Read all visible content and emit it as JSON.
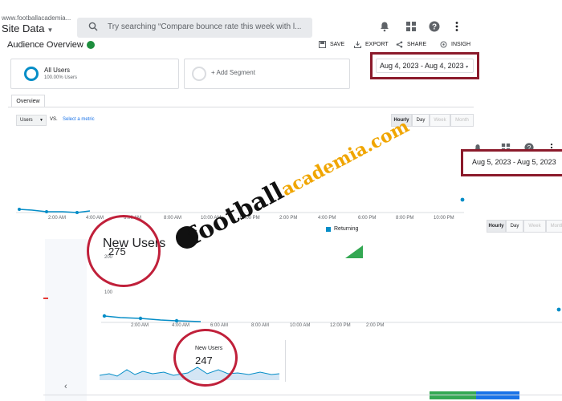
{
  "topbar": {
    "site_url": "www.footballacademia...",
    "site_title": "Site Data",
    "search_placeholder": "Try searching “Compare bounce rate this week with l..."
  },
  "page": {
    "title": "Audience Overview",
    "actions": [
      "SAVE",
      "EXPORT",
      "SHARE",
      "INSIGH"
    ]
  },
  "segments": {
    "all_users_label": "All Users",
    "all_users_sub": "100.00% Users",
    "add_segment": "+ Add Segment"
  },
  "tabs": {
    "overview": "Overview"
  },
  "metric_controls": {
    "metric": "Users",
    "vs": "VS.",
    "select_metric": "Select a metric",
    "time_buttons": [
      "Hourly",
      "Day",
      "Week",
      "Month"
    ]
  },
  "chart1": {
    "x_ticks": [
      "2:00 AM",
      "4:00 AM",
      "6:00 AM",
      "8:00 AM",
      "10:00 AM",
      "12:00 PM",
      "2:00 PM",
      "4:00 PM",
      "6:00 PM",
      "8:00 PM",
      "10:00 PM"
    ],
    "legend_returning": "Returning",
    "new_users_label": "New Users",
    "new_users_value": "275"
  },
  "date_ranges": {
    "first": "Aug 4, 2023 - Aug 4, 2023",
    "second": "Aug 5, 2023 - Aug 5, 2023"
  },
  "second_screen": {
    "time_buttons": [
      "Hourly",
      "Day",
      "Week",
      "Month"
    ],
    "y_ticks": [
      "200",
      "100"
    ],
    "x_ticks": [
      "2:00 AM",
      "4:00 AM",
      "6:00 AM",
      "8:00 AM",
      "10:00 AM",
      "12:00 PM",
      "2:00 PM"
    ],
    "new_users_label": "New Users",
    "new_users_value": "247"
  },
  "watermark": {
    "part1": "football",
    "part2": "academia.com"
  },
  "colors": {
    "accent_blue": "#058dc7",
    "highlight_red": "#c0203a",
    "date_box_border": "#8b1a2b",
    "verified_green": "#1e8e3e"
  }
}
